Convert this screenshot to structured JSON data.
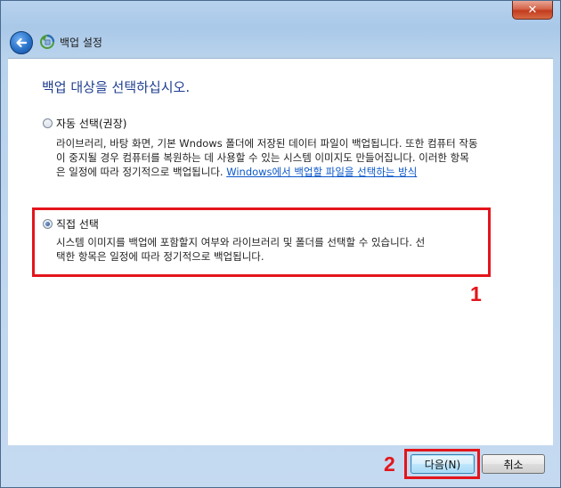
{
  "window": {
    "title": "백업 설정",
    "close_glyph": "✕"
  },
  "heading": "백업 대상을 선택하십시오.",
  "options": [
    {
      "label": "자동 선택(권장)",
      "selected": false,
      "description_lines": [
        "라이브러리, 바탕 화면, 기본 Wndows 폴더에 저장된 데이터 파일이 백업됩니다. 또한 컴퓨터 작동",
        "이 중지될 경우 컴퓨터를 복원하는 데 사용할 수 있는 시스템 이미지도 만들어집니다. 이러한 항목"
      ],
      "description_last_prefix": "은 일정에 따라 정기적으로 백업됩니다. ",
      "link_text": "Windows에서 백업할 파일을 선택하는 방식"
    },
    {
      "label": "직접 선택",
      "selected": true,
      "description_lines": [
        "시스템 이미지를 백업에 포함할지 여부와 라이브러리 및 폴더를 선택할 수 있습니다. 선",
        "택한 항목은 일정에 따라 정기적으로 백업됩니다."
      ]
    }
  ],
  "annotations": {
    "box1_number": "1",
    "box2_number": "2",
    "color": "#e3151b"
  },
  "buttons": {
    "next_label": "다음(N)",
    "cancel_label": "취소"
  },
  "icons": {
    "back": "back-arrow-icon",
    "backup": "backup-restore-icon",
    "close": "close-icon"
  }
}
